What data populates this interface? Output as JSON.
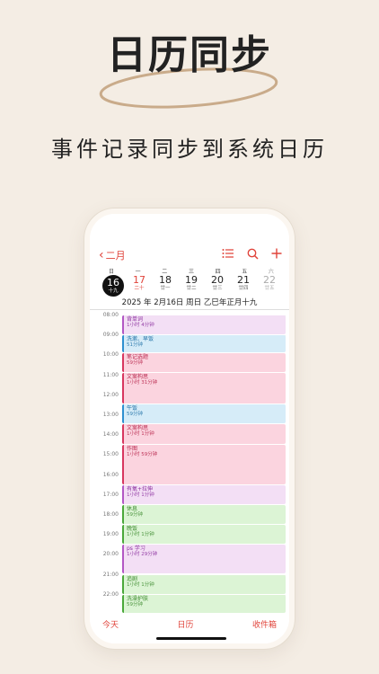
{
  "promo": {
    "title": "日历同步",
    "subtitle": "事件记录同步到系统日历"
  },
  "colors": {
    "accent": "#e0433a",
    "background": "#f4ede4"
  },
  "toolbar": {
    "back_label": "二月",
    "icons": [
      "chevron-left-icon",
      "list-icon",
      "search-icon",
      "plus-icon"
    ]
  },
  "week": {
    "weekdays": [
      "日",
      "一",
      "二",
      "三",
      "四",
      "五",
      "六"
    ],
    "days": [
      {
        "num": "16",
        "lunar": "十九"
      },
      {
        "num": "17",
        "lunar": "二十"
      },
      {
        "num": "18",
        "lunar": "廿一"
      },
      {
        "num": "19",
        "lunar": "廿二"
      },
      {
        "num": "20",
        "lunar": "廿三"
      },
      {
        "num": "21",
        "lunar": "廿四"
      },
      {
        "num": "22",
        "lunar": "廿五"
      }
    ]
  },
  "date_line": "2025 年 2月16日 周日  乙巳年正月十九",
  "hours": [
    "08:00",
    "09:00",
    "10:00",
    "11:00",
    "12:00",
    "13:00",
    "14:00",
    "15:00",
    "16:00",
    "17:00",
    "18:00",
    "19:00",
    "20:00",
    "21:00",
    "22:00"
  ],
  "events": [
    {
      "title": "背单词",
      "duration": "1小时 4分钟",
      "start": 8.0,
      "end": 8.95,
      "color": "purple"
    },
    {
      "title": "洗漱、早饭",
      "duration": "51分钟",
      "start": 9.0,
      "end": 9.85,
      "color": "blue"
    },
    {
      "title": "笔记选题",
      "duration": "59分钟",
      "start": 9.9,
      "end": 10.85,
      "color": "pink"
    },
    {
      "title": "文案构思",
      "duration": "1小时 31分钟",
      "start": 10.9,
      "end": 12.4,
      "color": "pink"
    },
    {
      "title": "午饭",
      "duration": "59分钟",
      "start": 12.45,
      "end": 13.4,
      "color": "blue"
    },
    {
      "title": "文案构思",
      "duration": "1小时 1分钟",
      "start": 13.45,
      "end": 14.45,
      "color": "pink"
    },
    {
      "title": "作图",
      "duration": "1小时 59分钟",
      "start": 14.5,
      "end": 16.45,
      "color": "pink"
    },
    {
      "title": "有氧+拉伸",
      "duration": "1小时 1分钟",
      "start": 16.5,
      "end": 17.45,
      "color": "purple"
    },
    {
      "title": "休息",
      "duration": "59分钟",
      "start": 17.5,
      "end": 18.45,
      "color": "green"
    },
    {
      "title": "晚饭",
      "duration": "1小时 1分钟",
      "start": 18.5,
      "end": 19.45,
      "color": "green"
    },
    {
      "title": "ps 学习",
      "duration": "1小时 29分钟",
      "start": 19.5,
      "end": 20.95,
      "color": "purple"
    },
    {
      "title": "追剧",
      "duration": "1小时 1分钟",
      "start": 21.0,
      "end": 21.95,
      "color": "green"
    },
    {
      "title": "洗澡护肤",
      "duration": "59分钟",
      "start": 22.0,
      "end": 22.9,
      "color": "green"
    }
  ],
  "bottom": {
    "today": "今天",
    "calendar": "日历",
    "inbox": "收件箱"
  }
}
